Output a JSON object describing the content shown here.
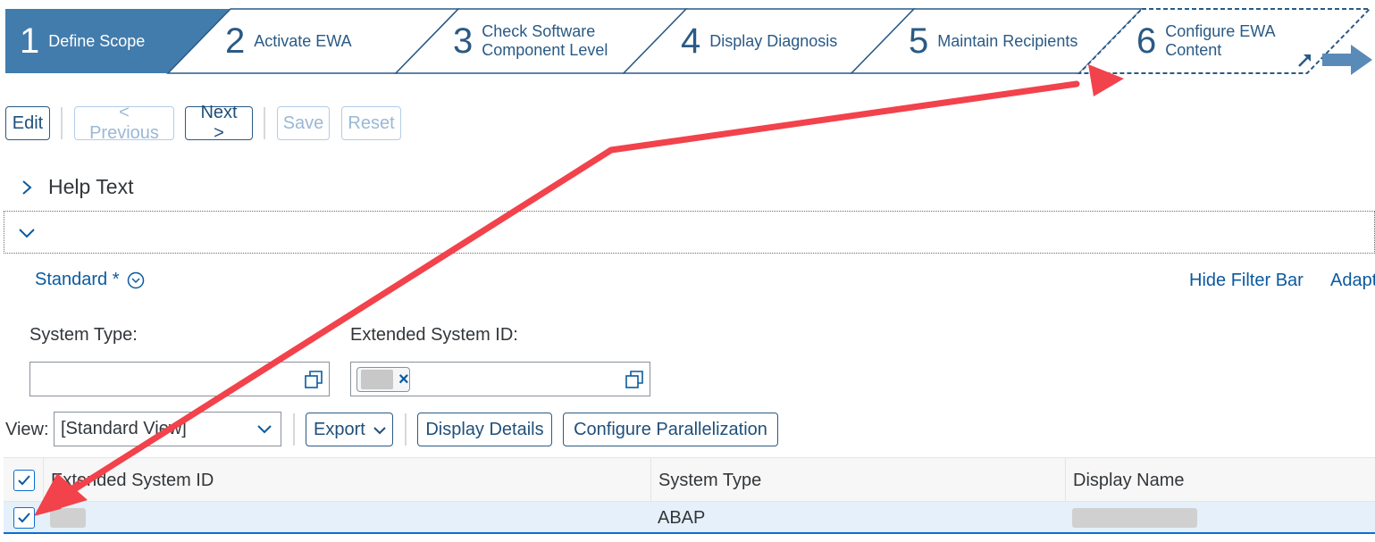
{
  "roadmap": {
    "steps": [
      {
        "num": "1",
        "label": "Define Scope",
        "active": true
      },
      {
        "num": "2",
        "label": "Activate EWA",
        "active": false
      },
      {
        "num": "3",
        "label": "Check Software Component Level",
        "active": false
      },
      {
        "num": "4",
        "label": "Display Diagnosis",
        "active": false
      },
      {
        "num": "5",
        "label": "Maintain Recipients",
        "active": false
      },
      {
        "num": "6",
        "label": "Configure EWA Content",
        "active": false
      }
    ]
  },
  "toolbar": {
    "edit_label": "Edit",
    "previous_label": "< Previous",
    "next_label": "Next >",
    "save_label": "Save",
    "reset_label": "Reset"
  },
  "help": {
    "title": "Help Text"
  },
  "filter_bar": {
    "variant_label": "Standard *",
    "hide_filter_bar_label": "Hide Filter Bar",
    "adapt_label": "Adapt",
    "system_type_label": "System Type:",
    "system_type_value": "",
    "extended_system_id_label": "Extended System ID:"
  },
  "table_toolbar": {
    "view_label": "View:",
    "view_value": "[Standard View]",
    "export_label": "Export",
    "display_details_label": "Display Details",
    "configure_parallelization_label": "Configure Parallelization"
  },
  "table": {
    "columns": [
      "Extended System ID",
      "System Type",
      "Display Name"
    ],
    "rows": [
      {
        "extended_system_id": "",
        "system_type": "ABAP",
        "display_name": "",
        "selected": true
      }
    ]
  },
  "colors": {
    "accent": "#0a6ed1",
    "active_step": "#427cac",
    "annotation_arrow": "#f2424b"
  }
}
